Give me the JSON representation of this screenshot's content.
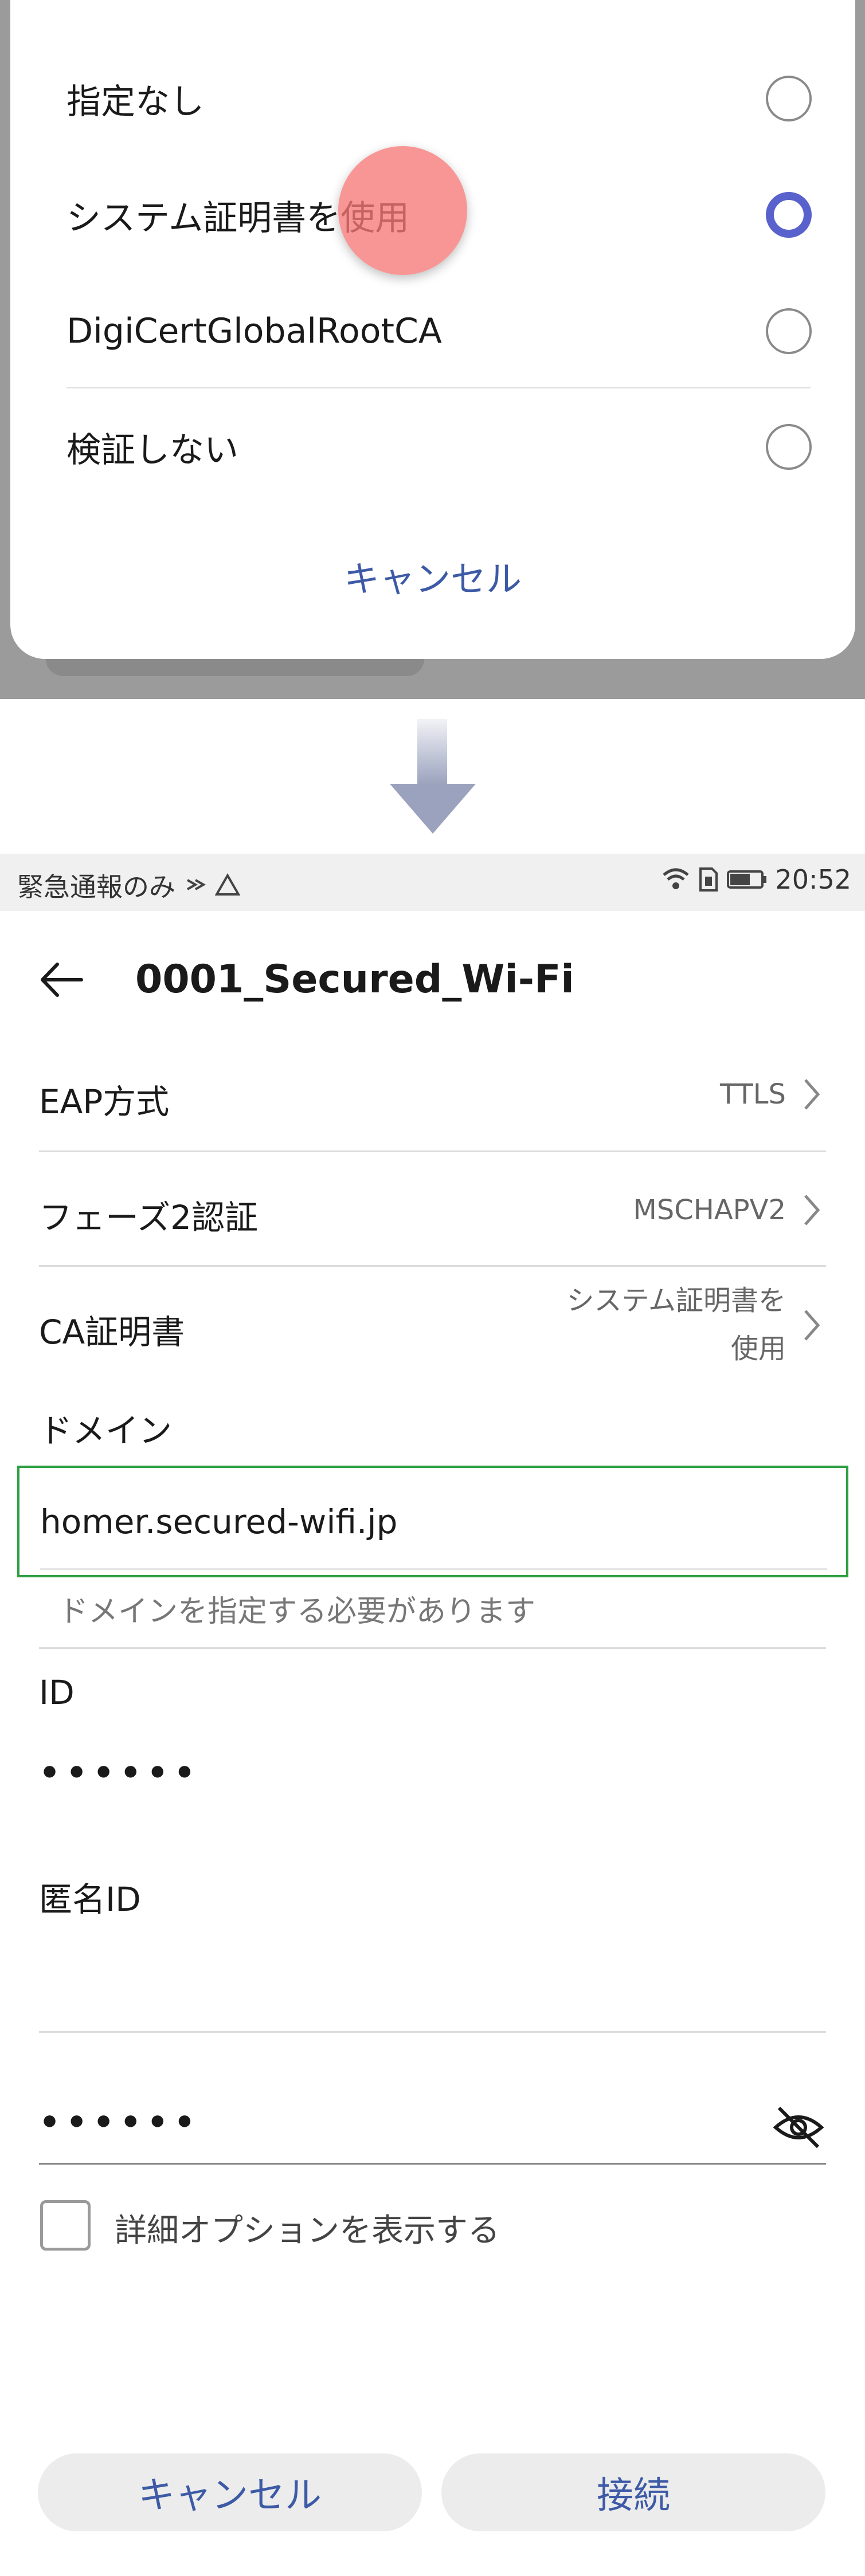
{
  "ca_dialog": {
    "options": [
      {
        "label": "指定なし",
        "selected": false
      },
      {
        "label": "システム証明書を使用",
        "selected": true
      },
      {
        "label": "DigiCertGlobalRootCA",
        "selected": false
      },
      {
        "label": "検証しない",
        "selected": false
      }
    ],
    "cancel_label": "キャンセル"
  },
  "status_bar": {
    "left_text": "緊急通報のみ",
    "time": "20:52"
  },
  "header": {
    "title": "0001_Secured_Wi-Fi"
  },
  "form": {
    "eap": {
      "label": "EAP方式",
      "value": "TTLS"
    },
    "phase2": {
      "label": "フェーズ2認証",
      "value": "MSCHAPV2"
    },
    "ca_cert": {
      "label": "CA証明書",
      "value_line1": "システム証明書を",
      "value_line2": "使用"
    },
    "domain": {
      "label": "ドメイン",
      "value": "homer.secured-wifi.jp",
      "hint": "ドメインを指定する必要があります"
    },
    "id": {
      "label": "ID",
      "value": "••••••"
    },
    "anon_id": {
      "label": "匿名ID",
      "value": ""
    },
    "password": {
      "value": "••••••"
    },
    "advanced_label": "詳細オプションを表示する"
  },
  "buttons": {
    "cancel": "キャンセル",
    "connect": "接続"
  },
  "colors": {
    "accent": "#3d5aa6",
    "radio_selected": "#5962cc",
    "focus_border": "#2ea043",
    "touch_indicator": "#f67878"
  }
}
